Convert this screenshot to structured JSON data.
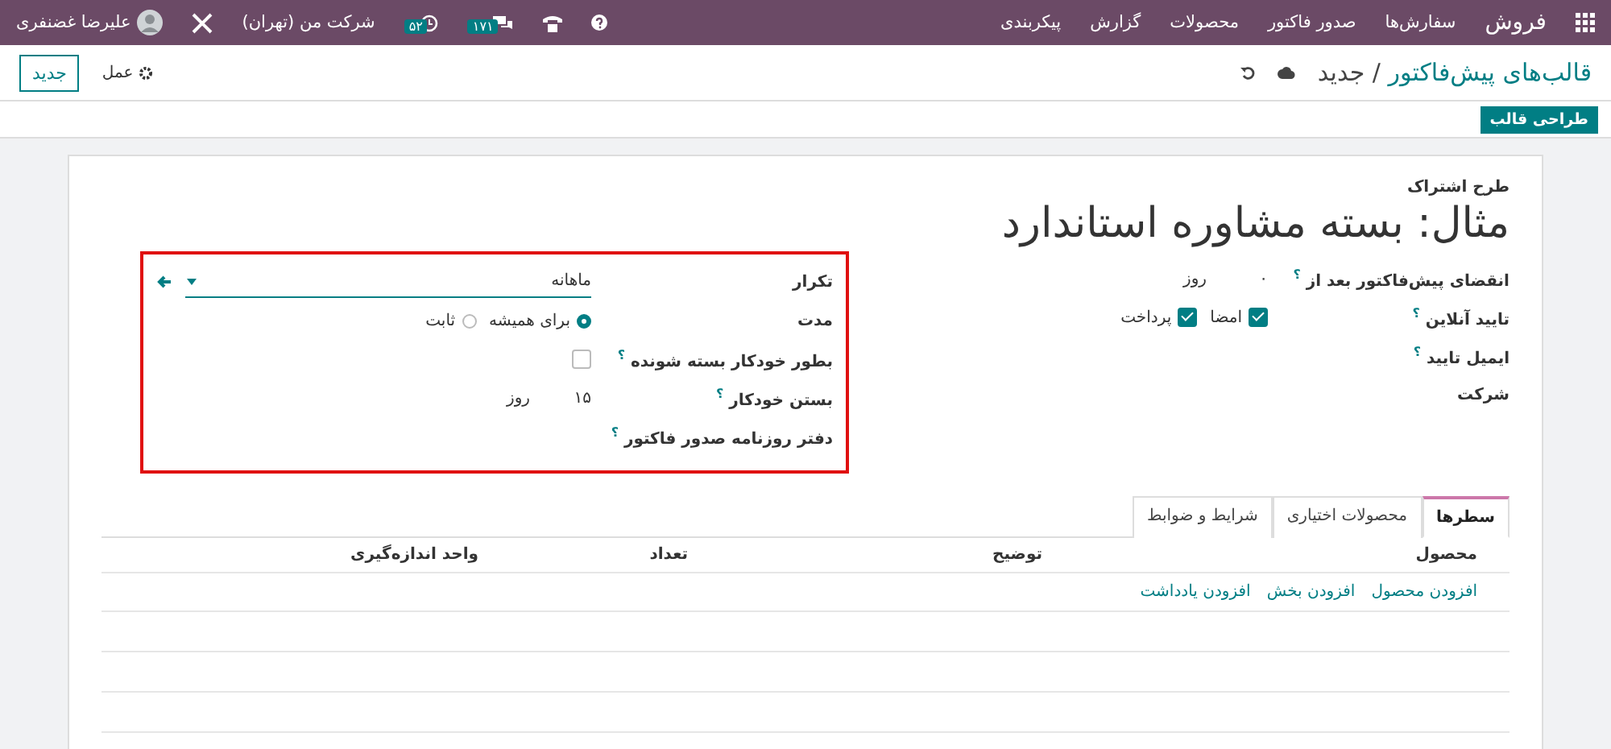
{
  "navbar": {
    "app": "فروش",
    "menu": [
      "سفارش‌ها",
      "صدور فاکتور",
      "محصولات",
      "گزارش",
      "پیکربندی"
    ],
    "messages_count": "۱۷۱",
    "activities_count": "۵۲",
    "company": "شرکت من (تهران)",
    "user": "علیرضا غضنفری"
  },
  "breadcrumb": {
    "parent": "قالب‌های پیش‌فاکتور",
    "separator": "/",
    "current": "جدید"
  },
  "action_menu": "عمل",
  "new_button": "جدید",
  "design_button": "طراحی قالب",
  "form": {
    "subtitle": "طرح اشتراک",
    "title": "مثال: بسته مشاوره استاندارد",
    "right_fields": [
      {
        "kind": "duration",
        "label": "انقضای پیش‌فاکتور بعد از",
        "help": "؟",
        "value": "۰",
        "unit": "روز"
      },
      {
        "kind": "checks",
        "label": "تایید آنلاین",
        "help": "؟",
        "options": [
          {
            "label": "امضا",
            "checked": true
          },
          {
            "label": "پرداخت",
            "checked": true
          }
        ]
      },
      {
        "kind": "empty",
        "label": "ایمیل تایید",
        "help": "؟"
      },
      {
        "kind": "empty",
        "label": "شرکت"
      }
    ],
    "left_fields": [
      {
        "kind": "select",
        "label": "تکرار",
        "value": "ماهانه"
      },
      {
        "kind": "radios",
        "label": "مدت",
        "options": [
          {
            "label": "برای همیشه",
            "selected": true
          },
          {
            "label": "ثابت",
            "selected": false
          }
        ]
      },
      {
        "kind": "checkbox",
        "label": "بطور خودکار بسته شونده",
        "help": "؟",
        "checked": false
      },
      {
        "kind": "duration",
        "label": "بستن خودکار",
        "help": "؟",
        "value": "۱۵",
        "unit": "روز"
      },
      {
        "kind": "empty",
        "label": "دفتر روزنامه صدور فاکتور",
        "help": "؟"
      }
    ],
    "highlighted": true
  },
  "tabs": [
    {
      "label": "سطرها",
      "selected": true
    },
    {
      "label": "محصولات اختیاری",
      "selected": false
    },
    {
      "label": "شرایط و ضوابط",
      "selected": false
    }
  ],
  "table": {
    "columns": [
      "محصول",
      "توضیح",
      "تعداد",
      "واحد اندازه‌گیری"
    ],
    "add_links": [
      "افزودن محصول",
      "افزودن بخش",
      "افزودن یادداشت"
    ]
  }
}
